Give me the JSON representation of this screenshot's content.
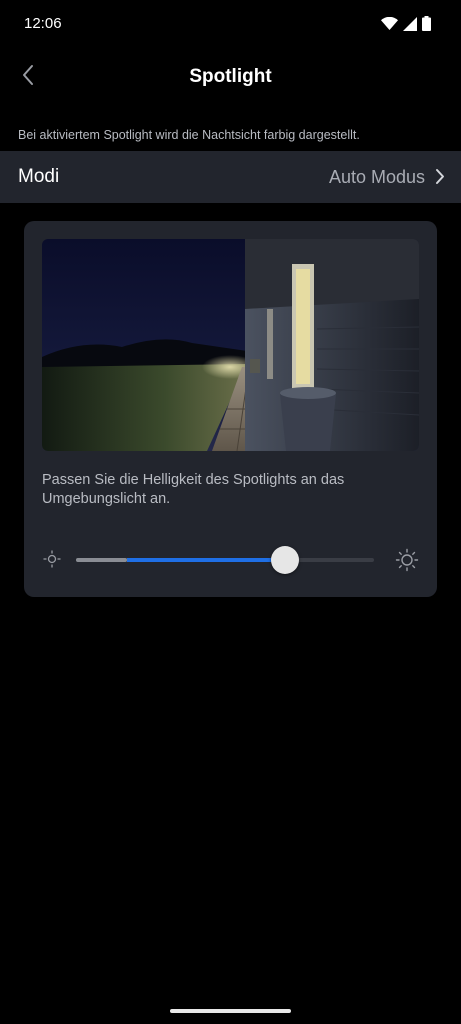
{
  "status_bar": {
    "time": "12:06",
    "icons": [
      "wifi-icon",
      "cellular-signal-icon",
      "battery-icon"
    ]
  },
  "header": {
    "title": "Spotlight",
    "back_icon": "chevron-left-icon"
  },
  "description": "Bei aktiviertem Spotlight wird die Nachtsicht farbig dargestellt.",
  "modi": {
    "label": "Modi",
    "value": "Auto Modus",
    "icon": "chevron-right-icon"
  },
  "card": {
    "preview_image": "night-camera-preview",
    "hint": "Passen Sie die Helligkeit des Spotlights an das Umgebungslicht an.",
    "slider": {
      "value": 0.7,
      "buffered": 0.17,
      "min_icon": "brightness-low-icon",
      "max_icon": "brightness-high-icon"
    }
  },
  "colors": {
    "background": "#000000",
    "surface": "#22252d",
    "accent": "#1f6fe5",
    "secondary_text": "#b9bcc3"
  }
}
